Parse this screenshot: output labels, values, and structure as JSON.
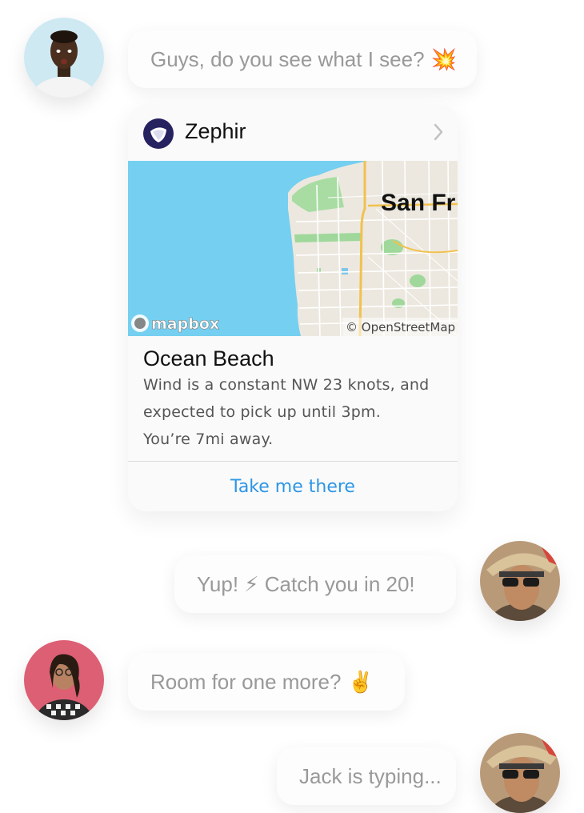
{
  "messages": [
    {
      "text": "Guys, do you see what I see?",
      "emoji": "💥"
    },
    {
      "text": "Yup! ⚡ Catch you in 20!"
    },
    {
      "text": "Room for one more?",
      "emoji": "✌️"
    },
    {
      "text": "Jack is typing..."
    }
  ],
  "card": {
    "app_name": "Zephir",
    "app_icon": "zephir-logo-icon",
    "map": {
      "city_label": "San Fr",
      "attribution": "© OpenStreetMap",
      "brand": "mapbox"
    },
    "place_title": "Ocean Beach",
    "description_lines": [
      "Wind is a constant NW 23 knots, and",
      "expected to pick up until 3pm.",
      "You’re 7mi away."
    ],
    "action_label": "Take me there"
  },
  "colors": {
    "accent": "#2d96e6",
    "ocean": "#75cff0",
    "land": "#ece8df",
    "park": "#9fd89a",
    "road": "#f2c14e",
    "bubble_text": "#999999"
  }
}
